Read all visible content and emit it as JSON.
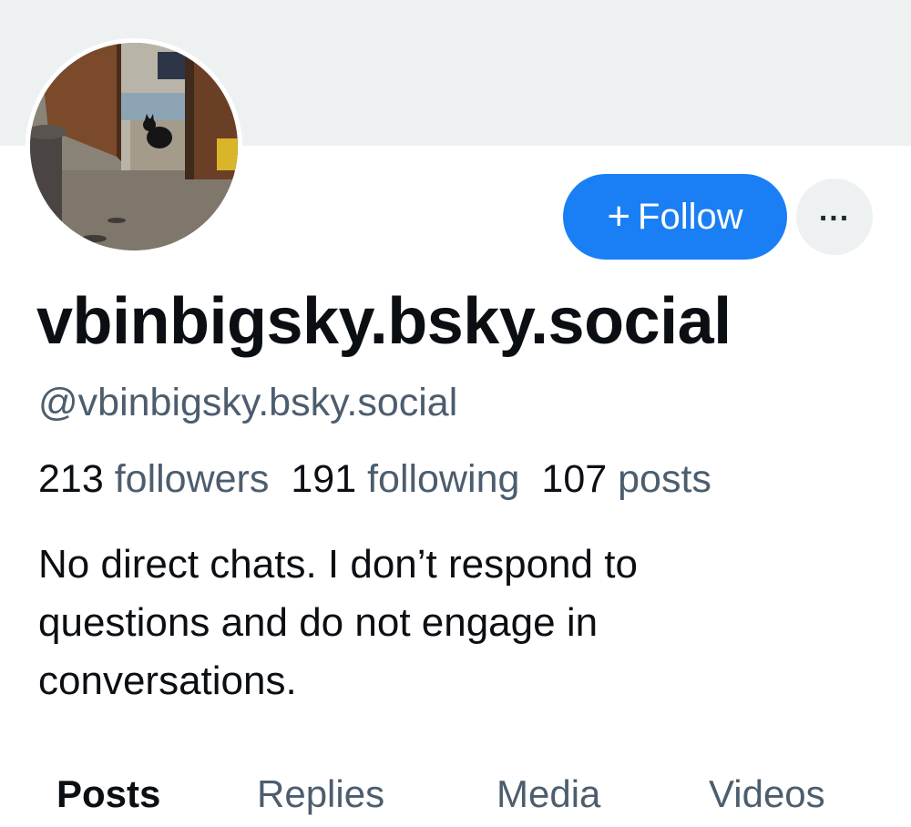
{
  "profile": {
    "display_name": "vbinbigsky.bsky.social",
    "handle": "@vbinbigsky.bsky.social",
    "stats": [
      {
        "value": "213",
        "label": "followers"
      },
      {
        "value": "191",
        "label": "following"
      },
      {
        "value": "107",
        "label": "posts"
      }
    ],
    "bio": "No direct chats. I don’t respond to questions and do not engage in conversations."
  },
  "actions": {
    "follow_label": "Follow",
    "follow_icon": "plus-icon",
    "more_icon": "more-horizontal-icon"
  },
  "tabs": [
    {
      "label": "Posts",
      "active": true
    },
    {
      "label": "Replies",
      "active": false
    },
    {
      "label": "Media",
      "active": false
    },
    {
      "label": "Videos",
      "active": false
    }
  ],
  "colors": {
    "accent": "#1a7ff5",
    "banner": "#eef1f2",
    "muted_text": "#4c5d6e"
  }
}
